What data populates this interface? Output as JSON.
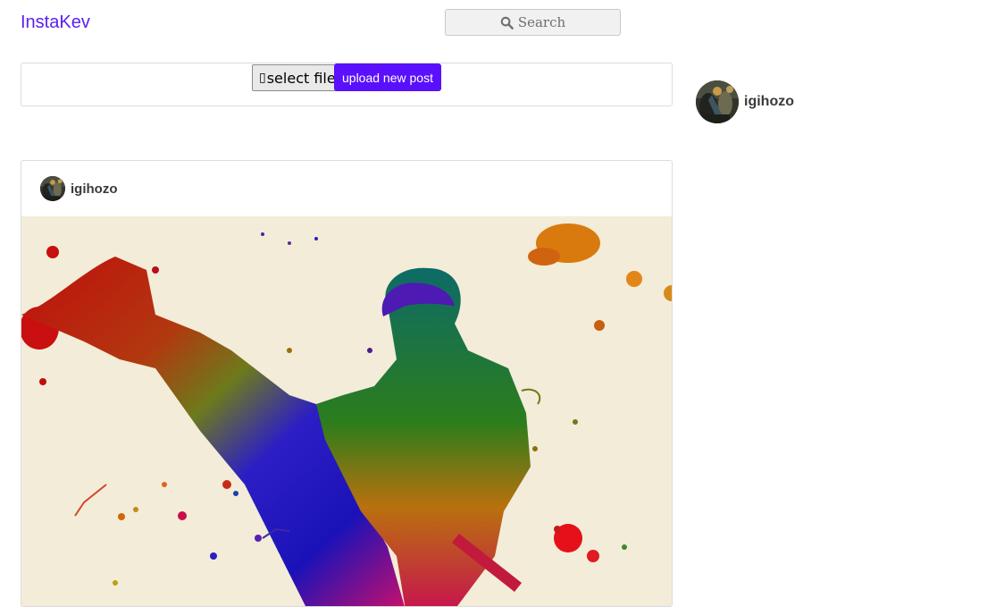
{
  "app": {
    "brand": "InstaKev"
  },
  "search": {
    "placeholder": "Search",
    "icon": "search-icon"
  },
  "upload": {
    "select_glyph": "▯",
    "select_label": "select file",
    "upload_label": "upload new post",
    "accent": "#5a10fc"
  },
  "sidebar": {
    "username": "igihozo"
  },
  "feed": {
    "posts": [
      {
        "username": "igihozo",
        "image": "watercolor-martial-artist-kick"
      }
    ]
  }
}
